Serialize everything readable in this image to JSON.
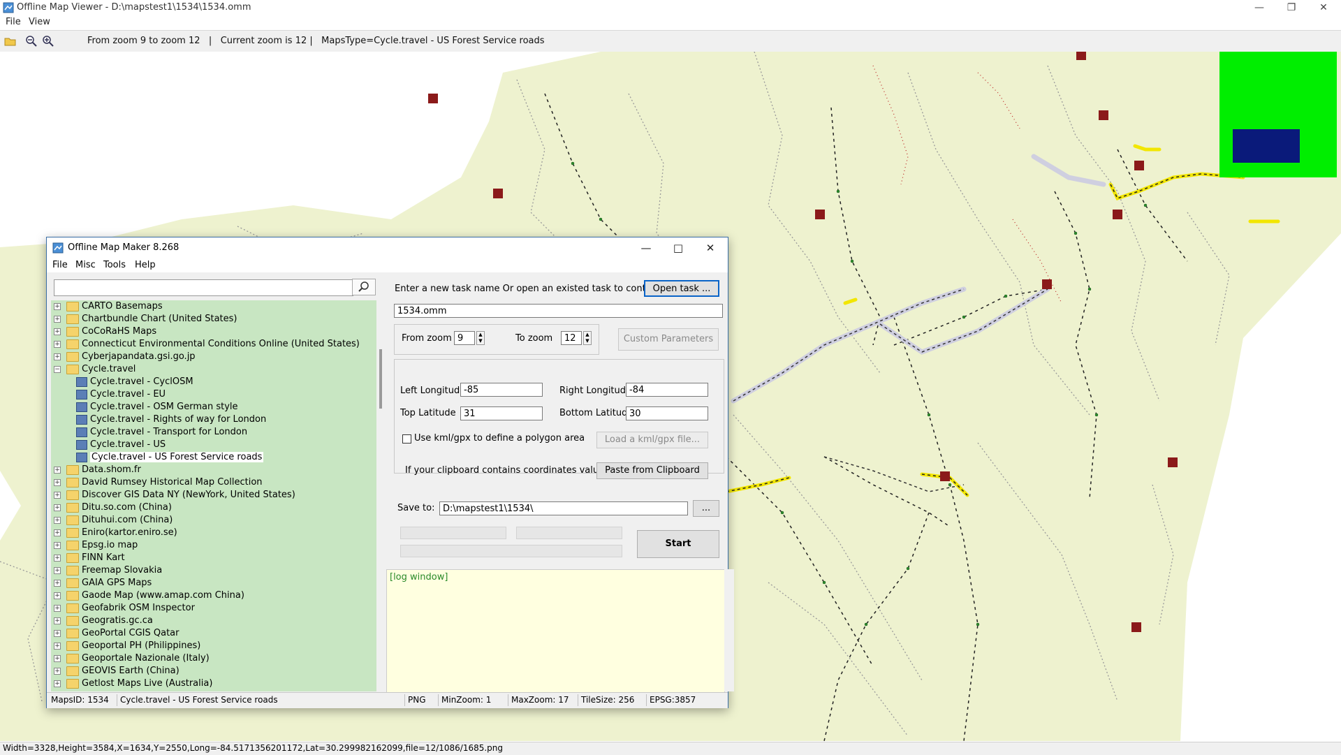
{
  "viewer": {
    "title": "Offline Map Viewer - D:\\mapstest1\\1534\\1534.omm",
    "menu": [
      "File",
      "View"
    ],
    "toolbar_info": "From zoom 9 to zoom 12   |   Current zoom is 12 |   MapsType=Cycle.travel - US Forest Service roads",
    "status": "Width=3328,Height=3584,X=1634,Y=2550,Long=-84.5171356201172,Lat=30.299982162099,file=12/1086/1685.png"
  },
  "dialog": {
    "title": "Offline Map Maker 8.268",
    "menu": [
      "File",
      "Misc",
      "Tools",
      "Help"
    ],
    "search_placeholder": "",
    "tree": [
      {
        "label": "CARTO Basemaps",
        "type": "folder",
        "expanded": false
      },
      {
        "label": "Chartbundle Chart (United States)",
        "type": "folder",
        "expanded": false
      },
      {
        "label": "CoCoRaHS Maps",
        "type": "folder",
        "expanded": false
      },
      {
        "label": "Connecticut Environmental Conditions Online (United States)",
        "type": "folder",
        "expanded": false
      },
      {
        "label": "Cyberjapandata.gsi.go.jp",
        "type": "folder",
        "expanded": false
      },
      {
        "label": "Cycle.travel",
        "type": "folder",
        "expanded": true
      },
      {
        "label": "Cycle.travel - CyclOSM",
        "type": "map"
      },
      {
        "label": "Cycle.travel - EU",
        "type": "map"
      },
      {
        "label": "Cycle.travel - OSM German style",
        "type": "map"
      },
      {
        "label": "Cycle.travel - Rights of way for London",
        "type": "map"
      },
      {
        "label": "Cycle.travel - Transport for London",
        "type": "map"
      },
      {
        "label": "Cycle.travel - US",
        "type": "map"
      },
      {
        "label": "Cycle.travel - US Forest Service roads",
        "type": "map",
        "selected": true
      },
      {
        "label": "Data.shom.fr",
        "type": "folder",
        "expanded": false
      },
      {
        "label": "David Rumsey Historical Map Collection",
        "type": "folder",
        "expanded": false
      },
      {
        "label": "Discover GIS Data NY (NewYork, United States)",
        "type": "folder",
        "expanded": false
      },
      {
        "label": "Ditu.so.com (China)",
        "type": "folder",
        "expanded": false
      },
      {
        "label": "Dituhui.com (China)",
        "type": "folder",
        "expanded": false
      },
      {
        "label": "Eniro(kartor.eniro.se)",
        "type": "folder",
        "expanded": false
      },
      {
        "label": "Epsg.io map",
        "type": "folder",
        "expanded": false
      },
      {
        "label": "FINN Kart",
        "type": "folder",
        "expanded": false
      },
      {
        "label": "Freemap Slovakia",
        "type": "folder",
        "expanded": false
      },
      {
        "label": "GAIA GPS Maps",
        "type": "folder",
        "expanded": false
      },
      {
        "label": "Gaode Map (www.amap.com China)",
        "type": "folder",
        "expanded": false
      },
      {
        "label": "Geofabrik OSM Inspector",
        "type": "folder",
        "expanded": false
      },
      {
        "label": "Geogratis.gc.ca",
        "type": "folder",
        "expanded": false
      },
      {
        "label": "GeoPortal CGIS Qatar",
        "type": "folder",
        "expanded": false
      },
      {
        "label": "Geoportal PH (Philippines)",
        "type": "folder",
        "expanded": false
      },
      {
        "label": "Geoportale Nazionale (Italy)",
        "type": "folder",
        "expanded": false
      },
      {
        "label": "GEOVIS Earth (China)",
        "type": "folder",
        "expanded": false
      },
      {
        "label": "Getlost Maps Live (Australia)",
        "type": "folder",
        "expanded": false
      }
    ],
    "form": {
      "task_prompt": "Enter a new task name Or open an existed task to continue:",
      "open_task_label": "Open task ...",
      "task_name": "1534.omm",
      "from_zoom_label": "From zoom",
      "from_zoom": "9",
      "to_zoom_label": "To zoom",
      "to_zoom": "12",
      "custom_params_label": "Custom Parameters",
      "left_lon_label": "Left Longitude",
      "left_lon": "-85",
      "right_lon_label": "Right Longitude",
      "right_lon": "-84",
      "top_lat_label": "Top Latitude",
      "top_lat": "31",
      "bottom_lat_label": "Bottom Latitude",
      "bottom_lat": "30",
      "kml_label": "Use kml/gpx to define a polygon area",
      "kml_checked": false,
      "load_kml_label": "Load a kml/gpx file...",
      "clipboard_prompt": "If your clipboard contains coordinates values:",
      "paste_label": "Paste from Clipboard",
      "save_to_label": "Save to:",
      "save_to": "D:\\mapstest1\\1534\\",
      "browse_label": "...",
      "start_label": "Start",
      "log_text": "[log window]"
    },
    "status": {
      "maps_id": "MapsID: 1534",
      "map_name": "Cycle.travel - US Forest Service roads",
      "format": "PNG",
      "min_zoom": "MinZoom: 1",
      "max_zoom": "MaxZoom: 17",
      "tile_size": "TileSize: 256",
      "epsg": "EPSG:3857"
    }
  },
  "colors": {
    "land": "#eef2cf",
    "tree_bg": "#c8e6c2",
    "overview_bg": "#00ee00",
    "overview_rect": "#0a1a7a",
    "highlight_road": "#f2e600",
    "poi": "#8b1a1a",
    "log_bg": "#ffffe0"
  }
}
